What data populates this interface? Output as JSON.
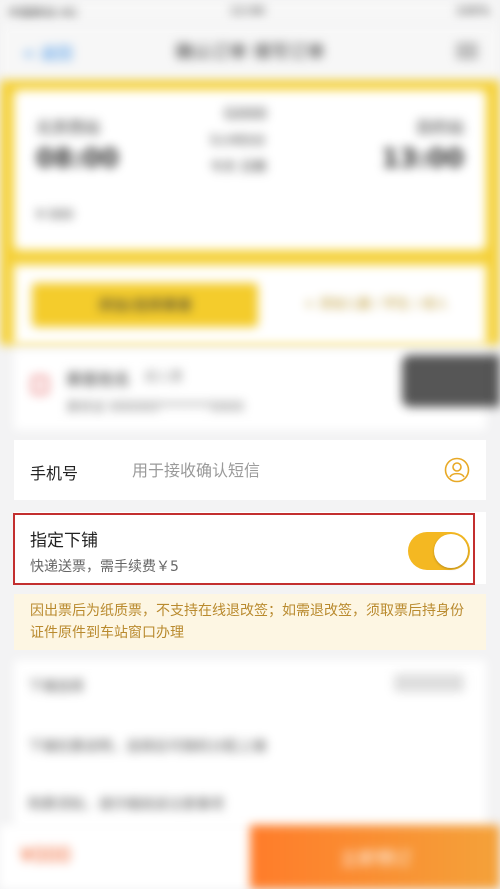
{
  "status_bar": {
    "left": "中国移动 4G",
    "center": "12:00",
    "right": "100%"
  },
  "nav": {
    "back_label": "< 返回",
    "title": "确认订单 填写订单"
  },
  "ticket": {
    "from_station": "北京西站",
    "from_time": "08:00",
    "train_no": "G000",
    "duration": "5小时0分",
    "to_station": "目的站",
    "to_time": "13:00",
    "date": "今天 日期",
    "price_note": "¥ 000"
  },
  "actions": {
    "primary": "添加/选择乘客",
    "secondary": "+ 添加儿童 / 学生 / 成人"
  },
  "passenger": {
    "name": "乘客姓名",
    "type": "成人票",
    "id_number": "身份证 000000********0000"
  },
  "phone": {
    "label": "手机号",
    "placeholder": "用于接收确认短信"
  },
  "bunk": {
    "title": "指定下铺",
    "subtitle": "快递送票，需手续费￥5",
    "enabled": true,
    "accent": "#f4b822"
  },
  "notice": {
    "text": "因出票后为纸质票，不支持在线退改签；如需退改签，须取票后持身份证件原件到车站窗口办理"
  },
  "lower": {
    "row1": "下铺选择",
    "row2": "下铺优惠说明，选择后可随机分配上铺",
    "row3": "购票须知，请仔细阅读注意事项"
  },
  "bottom": {
    "price": "¥000",
    "pay_label": "立即预订"
  },
  "colors": {
    "header_yellow": "#f5d23b",
    "highlight_border": "#c32f2f",
    "notice_text": "#b98a2e"
  }
}
